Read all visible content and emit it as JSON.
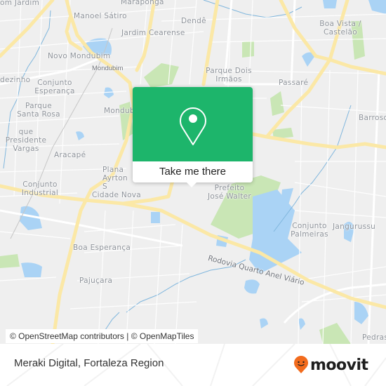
{
  "map": {
    "labels": [
      {
        "text": "om Jardim",
        "cls": ""
      },
      {
        "text": "Maraponga",
        "cls": ""
      },
      {
        "text": "Manoel Sátiro",
        "cls": ""
      },
      {
        "text": "Dendê",
        "cls": ""
      },
      {
        "text": "Jardim Cearense",
        "cls": ""
      },
      {
        "text": "Boa Vista / Castelão",
        "cls": ""
      },
      {
        "text": "Novo Mondubim",
        "cls": ""
      },
      {
        "text": "Mondubim",
        "cls": "sm"
      },
      {
        "text": "Parque Dois Irmãos",
        "cls": ""
      },
      {
        "text": "dezinho",
        "cls": ""
      },
      {
        "text": "Conjunto Esperança",
        "cls": ""
      },
      {
        "text": "Passaré",
        "cls": ""
      },
      {
        "text": "Parque Santa Rosa",
        "cls": ""
      },
      {
        "text": "Mondub",
        "cls": ""
      },
      {
        "text": "Barroso",
        "cls": ""
      },
      {
        "text": "que Presidente Vargas",
        "cls": ""
      },
      {
        "text": "Aracapé",
        "cls": ""
      },
      {
        "text": "Plana Ayrton S",
        "cls": ""
      },
      {
        "text": "Conjunto Industrial",
        "cls": ""
      },
      {
        "text": "Cidade Nova",
        "cls": ""
      },
      {
        "text": "Prefeito José Walter",
        "cls": ""
      },
      {
        "text": "Conjunto Palmeiras",
        "cls": ""
      },
      {
        "text": "Jangurussu",
        "cls": ""
      },
      {
        "text": "Boa Esperança",
        "cls": ""
      },
      {
        "text": "Pajuçara",
        "cls": ""
      },
      {
        "text": "Pedras",
        "cls": ""
      }
    ],
    "road_label": "Rodovia Quarto Anel Viário",
    "attribution": "© OpenStreetMap contributors | © OpenMapTiles",
    "colors": {
      "land": "#efefef",
      "road_major": "#fbe8a6",
      "water": "#aad3f5",
      "park": "#c9e6b5"
    }
  },
  "popup": {
    "cta_label": "Take me there",
    "icon": "map-pin-icon",
    "color": "#1db56b"
  },
  "footer": {
    "title": "Meraki Digital, Fortaleza Region",
    "logo_text": "moovit",
    "logo_icon": "moovit-smiley-pin-icon",
    "logo_color": "#f26b1d"
  }
}
